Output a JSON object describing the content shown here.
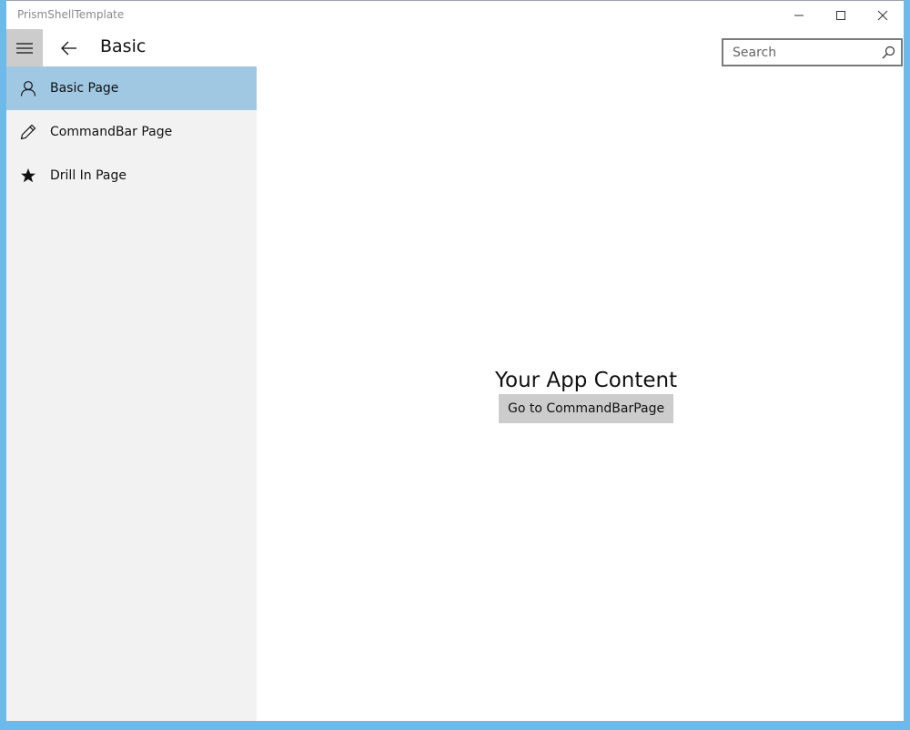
{
  "window": {
    "title": "PrismShellTemplate",
    "caption_buttons": {
      "minimize_icon": "minimize-icon",
      "maximize_icon": "maximize-icon",
      "close_icon": "close-icon"
    }
  },
  "header": {
    "hamburger_icon": "hamburger-icon",
    "back_icon": "back-arrow-icon",
    "title": "Basic",
    "search": {
      "placeholder": "Search",
      "value": "",
      "icon": "search-icon"
    }
  },
  "nav": {
    "items": [
      {
        "label": "Basic Page",
        "icon": "person-icon",
        "selected": true
      },
      {
        "label": "CommandBar Page",
        "icon": "pencil-icon",
        "selected": false
      },
      {
        "label": "Drill In Page",
        "icon": "star-icon",
        "selected": false
      }
    ]
  },
  "content": {
    "heading": "Your App Content",
    "button_label": "Go to CommandBarPage"
  },
  "colors": {
    "accent_border": "#6cb9ea",
    "nav_selected": "#a0c8e2",
    "nav_background": "#f2f2f2",
    "button_background": "#cccccc"
  }
}
